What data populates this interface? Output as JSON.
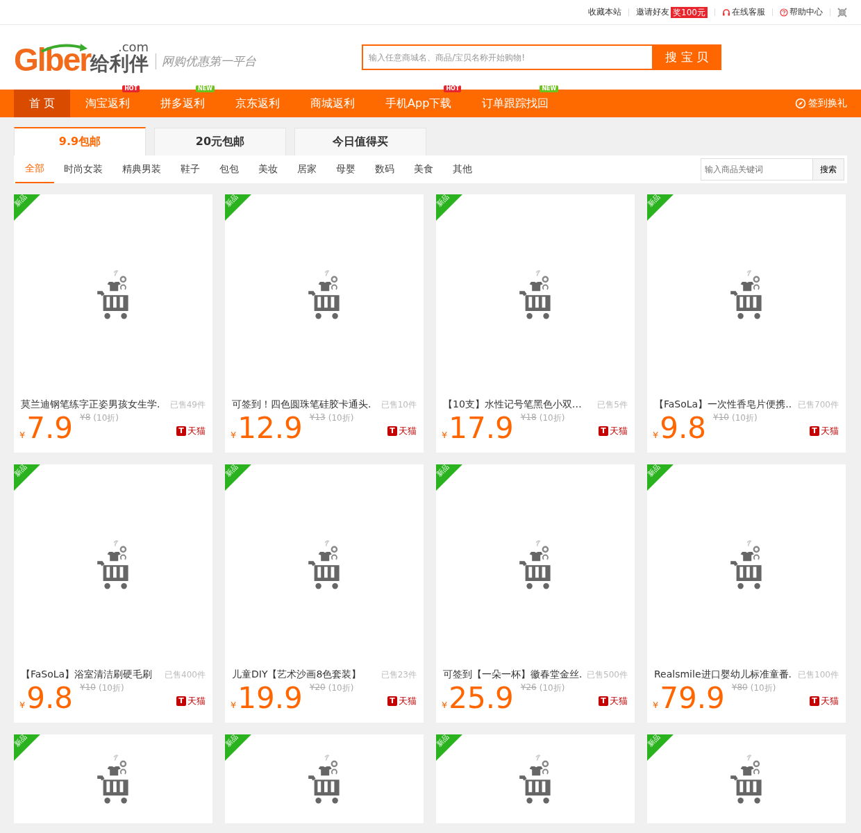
{
  "top_bar": {
    "links": [
      {
        "kind": "plain",
        "label": "收藏本站"
      },
      {
        "kind": "invite",
        "label": "邀请好友",
        "badge": "奖100元"
      },
      {
        "kind": "service",
        "label": "在线客服"
      },
      {
        "kind": "help",
        "label": "帮助中心"
      },
      {
        "kind": "collapse"
      }
    ]
  },
  "header": {
    "logo": {
      "brand": "Glber",
      "domain": ".com",
      "name": "给利伴",
      "slogan": "网购优惠第一平台"
    },
    "search": {
      "placeholder": "输入任意商城名、商品/宝贝名称开始购物!",
      "button": "搜 宝 贝"
    }
  },
  "nav": {
    "items": [
      {
        "label": "首 页",
        "selected": true
      },
      {
        "label": "淘宝返利",
        "selected": false,
        "badge": "HOT"
      },
      {
        "label": "拼多返利",
        "selected": false,
        "badge": "NEW"
      },
      {
        "label": "京东返利",
        "selected": false
      },
      {
        "label": "商城返利",
        "selected": false
      },
      {
        "label": "手机App下载",
        "selected": false,
        "badge": "HOT"
      },
      {
        "label": "订单跟踪找回",
        "selected": false,
        "badge": "NEW"
      }
    ],
    "sign_in": "签到换礼"
  },
  "tabs": [
    {
      "label": "9.9包邮",
      "selected": true
    },
    {
      "label": "20元包邮",
      "selected": false
    },
    {
      "label": "今日值得买",
      "selected": false
    }
  ],
  "categories": [
    {
      "label": "全部",
      "selected": true
    },
    {
      "label": "时尚女装",
      "selected": false
    },
    {
      "label": "精典男装",
      "selected": false
    },
    {
      "label": "鞋子",
      "selected": false
    },
    {
      "label": "包包",
      "selected": false
    },
    {
      "label": "美妆",
      "selected": false
    },
    {
      "label": "居家",
      "selected": false
    },
    {
      "label": "母婴",
      "selected": false
    },
    {
      "label": "数码",
      "selected": false
    },
    {
      "label": "美食",
      "selected": false
    },
    {
      "label": "其他",
      "selected": false
    }
  ],
  "keyword_search": {
    "placeholder": "输入商品关键词",
    "button": "搜索"
  },
  "products": [
    {
      "kind": "full",
      "badge": "新品",
      "title": "莫兰迪钢笔练字正姿男孩女生学.",
      "sold": "已售49件",
      "currency": "¥",
      "price": "7.9",
      "old_price": "¥8",
      "discount": "(10折)",
      "platform_mark": "T",
      "platform": "天猫"
    },
    {
      "kind": "full",
      "badge": "新品",
      "title": "可签到！四色圆珠笔硅胶卡通头.",
      "sold": "已售10件",
      "currency": "¥",
      "price": "12.9",
      "old_price": "¥13",
      "discount": "(10折)",
      "platform_mark": "T",
      "platform": "天猫"
    },
    {
      "kind": "full",
      "badge": "新品",
      "title": "【10支】水性记号笔黑色小双…",
      "sold": "已售5件",
      "currency": "¥",
      "price": "17.9",
      "old_price": "¥18",
      "discount": "(10折)",
      "platform_mark": "T",
      "platform": "天猫"
    },
    {
      "kind": "full",
      "badge": "新品",
      "title": "【FaSoLa】一次性香皂片便携..",
      "sold": "已售700件",
      "currency": "¥",
      "price": "9.8",
      "old_price": "¥10",
      "discount": "(10折)",
      "platform_mark": "T",
      "platform": "天猫"
    },
    {
      "kind": "full",
      "badge": "新品",
      "title": "【FaSoLa】浴室清洁刷硬毛刷",
      "sold": "已售400件",
      "currency": "¥",
      "price": "9.8",
      "old_price": "¥10",
      "discount": "(10折)",
      "platform_mark": "T",
      "platform": "天猫"
    },
    {
      "kind": "full",
      "badge": "新品",
      "title": "儿童DIY【艺术沙画8色套装】",
      "sold": "已售23件",
      "currency": "¥",
      "price": "19.9",
      "old_price": "¥20",
      "discount": "(10折)",
      "platform_mark": "T",
      "platform": "天猫"
    },
    {
      "kind": "full",
      "badge": "新品",
      "title": "可签到【一朵一杯】徽春堂金丝.",
      "sold": "已售500件",
      "currency": "¥",
      "price": "25.9",
      "old_price": "¥26",
      "discount": "(10折)",
      "platform_mark": "T",
      "platform": "天猫"
    },
    {
      "kind": "full",
      "badge": "新品",
      "title": "Realsmile进口婴幼儿标准童番.",
      "sold": "已售100件",
      "currency": "¥",
      "price": "79.9",
      "old_price": "¥80",
      "discount": "(10折)",
      "platform_mark": "T",
      "platform": "天猫"
    },
    {
      "kind": "cut",
      "badge": "新品"
    },
    {
      "kind": "cut",
      "badge": "新品"
    },
    {
      "kind": "cut",
      "badge": "新品"
    },
    {
      "kind": "cut",
      "badge": "新品"
    }
  ]
}
